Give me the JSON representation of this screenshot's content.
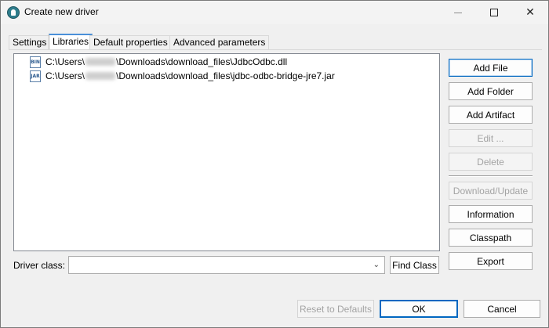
{
  "window": {
    "title": "Create new driver"
  },
  "tabs": [
    {
      "label": "Settings",
      "active": false
    },
    {
      "label": "Libraries",
      "active": true
    },
    {
      "label": "Default properties",
      "active": false
    },
    {
      "label": "Advanced parameters",
      "active": false
    }
  ],
  "files": [
    {
      "icon": "BIN",
      "prefix": "C:\\Users\\",
      "suffix": "\\Downloads\\download_files\\JdbcOdbc.dll"
    },
    {
      "icon": "JAR",
      "prefix": "C:\\Users\\",
      "suffix": "\\Downloads\\download_files\\jdbc-odbc-bridge-jre7.jar"
    }
  ],
  "side_buttons": {
    "add_file": "Add File",
    "add_folder": "Add Folder",
    "add_artifact": "Add Artifact",
    "edit": "Edit ...",
    "delete": "Delete",
    "download_update": "Download/Update",
    "information": "Information",
    "classpath": "Classpath",
    "export": "Export"
  },
  "driver_class": {
    "label": "Driver class:",
    "value": "",
    "find_class": "Find Class"
  },
  "footer": {
    "reset": "Reset to Defaults",
    "ok": "OK",
    "cancel": "Cancel"
  },
  "colors": {
    "accent": "#0067c0",
    "disabled_text": "#a3a3a3"
  }
}
